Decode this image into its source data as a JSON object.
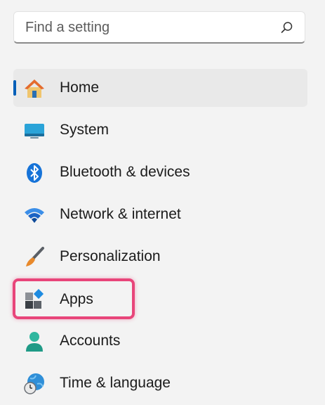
{
  "search": {
    "placeholder": "Find a setting"
  },
  "nav": {
    "items": [
      {
        "label": "Home",
        "icon": "home-icon",
        "selected": true
      },
      {
        "label": "System",
        "icon": "system-icon"
      },
      {
        "label": "Bluetooth & devices",
        "icon": "bluetooth-icon"
      },
      {
        "label": "Network & internet",
        "icon": "wifi-icon"
      },
      {
        "label": "Personalization",
        "icon": "brush-icon"
      },
      {
        "label": "Apps",
        "icon": "apps-icon",
        "highlighted": true
      },
      {
        "label": "Accounts",
        "icon": "account-icon"
      },
      {
        "label": "Time & language",
        "icon": "time-language-icon"
      }
    ]
  },
  "colors": {
    "accent": "#005fb8",
    "highlight": "#e8457a",
    "background": "#f3f3f3"
  }
}
